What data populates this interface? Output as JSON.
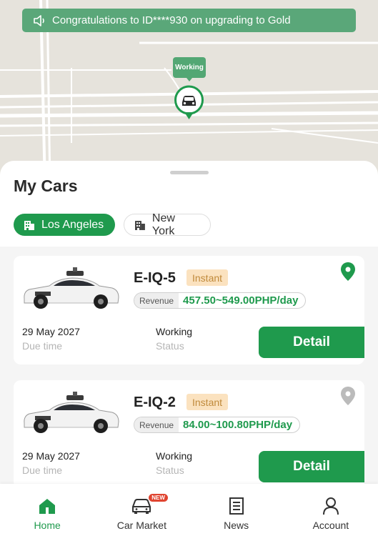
{
  "notice": {
    "text": "Congratulations to ID****930 on upgrading to Gold",
    "icon": "speaker-icon"
  },
  "map": {
    "marker_status": "Working",
    "marker_icon": "car-icon"
  },
  "page_title": "My Cars",
  "city_tabs": [
    {
      "label": "Los Angeles",
      "active": true,
      "icon": "building-icon"
    },
    {
      "label": "New York",
      "active": false,
      "icon": "building-icon"
    }
  ],
  "cars": [
    {
      "name": "E-IQ-5",
      "badge": "Instant",
      "revenue_label": "Revenue",
      "revenue_value": "457.50~549.00PHP/day",
      "due_date": "29 May 2027",
      "due_label": "Due time",
      "status": "Working",
      "status_label": "Status",
      "detail_label": "Detail",
      "location_pin_color": "#1f9a4d"
    },
    {
      "name": "E-IQ-2",
      "badge": "Instant",
      "revenue_label": "Revenue",
      "revenue_value": "84.00~100.80PHP/day",
      "due_date": "29 May 2027",
      "due_label": "Due time",
      "status": "Working",
      "status_label": "Status",
      "detail_label": "Detail",
      "location_pin_color": "#bbbbbb"
    }
  ],
  "bottom_nav": [
    {
      "label": "Home",
      "icon": "home-icon",
      "active": true
    },
    {
      "label": "Car Market",
      "icon": "car-icon",
      "active": false,
      "badge": "NEW"
    },
    {
      "label": "News",
      "icon": "news-icon",
      "active": false
    },
    {
      "label": "Account",
      "icon": "account-icon",
      "active": false
    }
  ],
  "colors": {
    "accent": "#1f9a4d",
    "notice_bg": "#5aa779",
    "badge_bg": "#fbe2bf",
    "new_badge": "#e04430"
  }
}
